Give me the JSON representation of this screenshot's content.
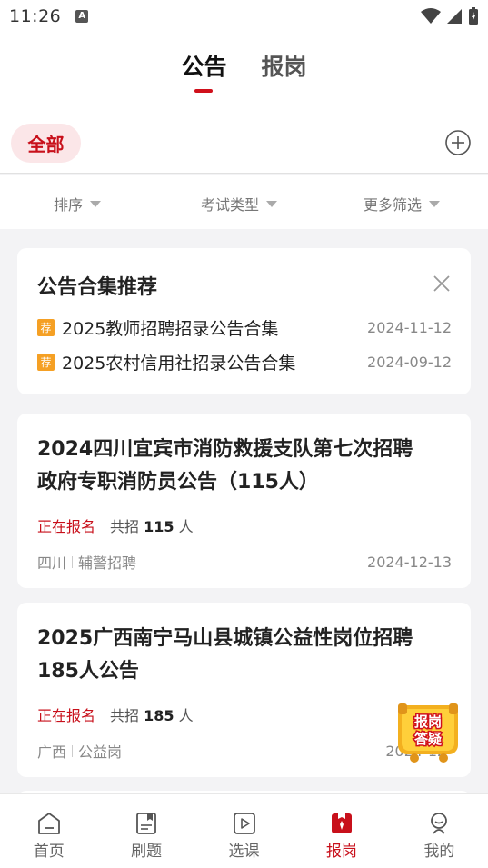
{
  "status_bar": {
    "time": "11:26",
    "notification_icon": "A"
  },
  "header": {
    "tabs": [
      {
        "label": "公告",
        "active": true
      },
      {
        "label": "报岗",
        "active": false
      }
    ]
  },
  "filter": {
    "chip_label": "全部"
  },
  "sort_bar": {
    "items": [
      {
        "label": "排序"
      },
      {
        "label": "考试类型"
      },
      {
        "label": "更多筛选"
      }
    ]
  },
  "recommend": {
    "title": "公告合集推荐",
    "badge": "荐",
    "items": [
      {
        "name": "2025教师招聘招录公告合集",
        "date": "2024-11-12"
      },
      {
        "name": "2025农村信用社招录公告合集",
        "date": "2024-09-12"
      }
    ]
  },
  "jobs": [
    {
      "title_line1": "2024四川宜宾市消防救援支队第七次招聘",
      "title_line2": "政府专职消防员公告（115人）",
      "status": "正在报名",
      "total_prefix": "共招",
      "total_count": "115",
      "total_unit": "人",
      "region": "四川",
      "category": "辅警招聘",
      "date": "2024-12-13"
    },
    {
      "title_line1": "2025广西南宁马山县城镇公益性岗位招聘",
      "title_line2": "185人公告",
      "status": "正在报名",
      "total_prefix": "共招",
      "total_count": "185",
      "total_unit": "人",
      "region": "广西",
      "category": "公益岗",
      "date": "2024-12-"
    }
  ],
  "help_badge": {
    "line1": "报岗",
    "line2": "答疑"
  },
  "bottom_nav": [
    {
      "label": "首页",
      "icon": "home-icon",
      "active": false
    },
    {
      "label": "刷题",
      "icon": "practice-icon",
      "active": false
    },
    {
      "label": "选课",
      "icon": "course-icon",
      "active": false
    },
    {
      "label": "报岗",
      "icon": "job-icon",
      "active": true
    },
    {
      "label": "我的",
      "icon": "profile-icon",
      "active": false
    }
  ],
  "colors": {
    "accent": "#c8101b",
    "chip_bg": "#fbe6e8",
    "badge_orange": "#f5a024"
  }
}
